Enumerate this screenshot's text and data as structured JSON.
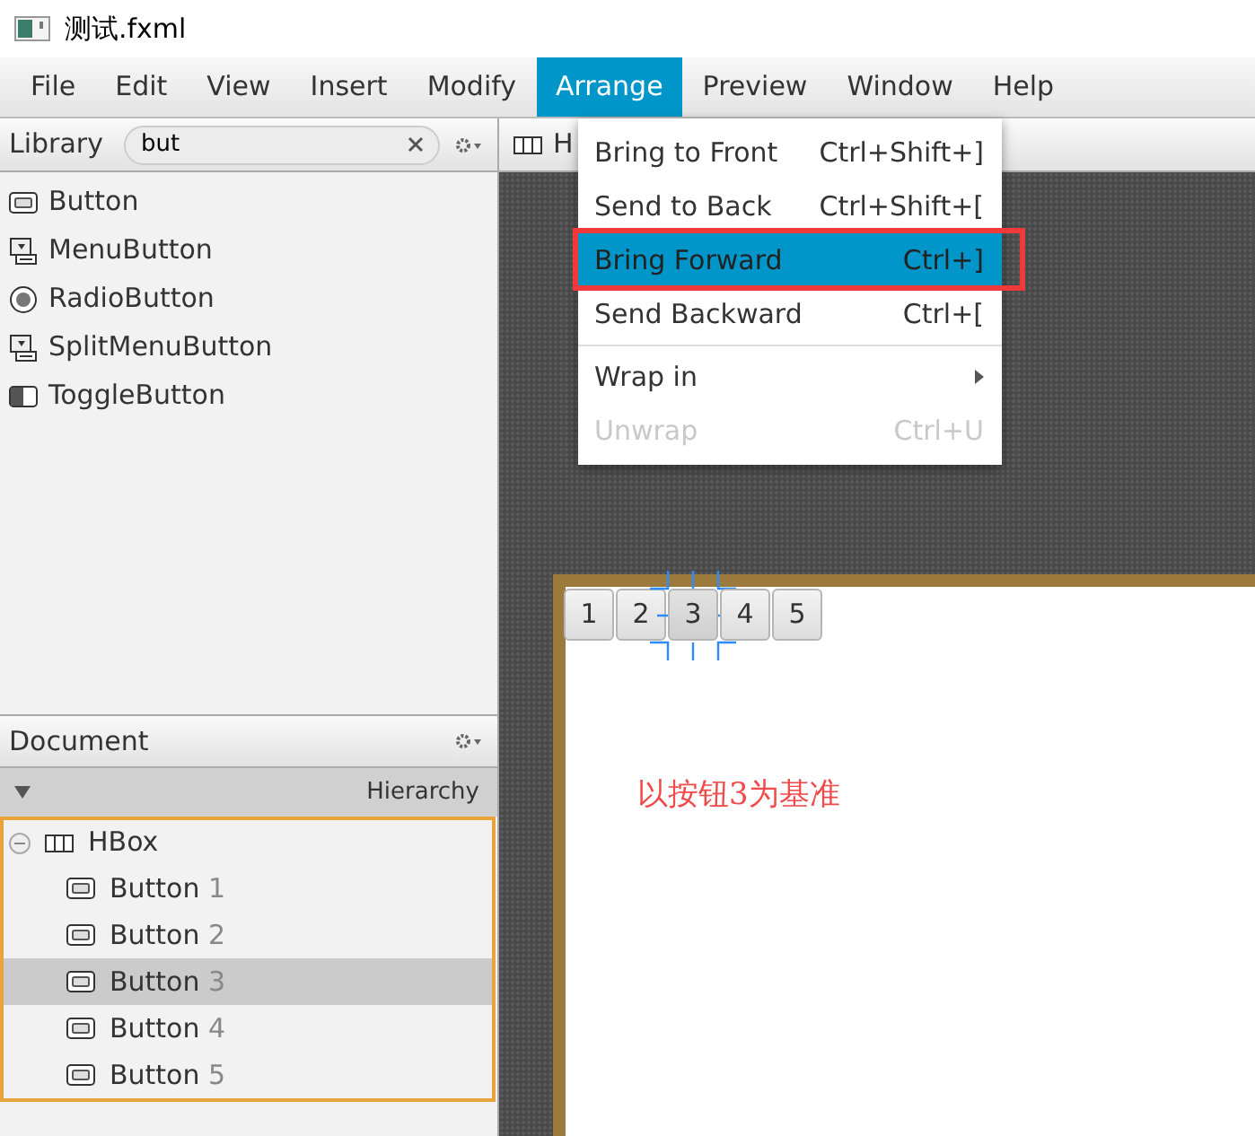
{
  "window": {
    "title": "测试.fxml"
  },
  "menu_bar": [
    {
      "label": "File",
      "selected": false
    },
    {
      "label": "Edit",
      "selected": false
    },
    {
      "label": "View",
      "selected": false
    },
    {
      "label": "Insert",
      "selected": false
    },
    {
      "label": "Modify",
      "selected": false
    },
    {
      "label": "Arrange",
      "selected": true
    },
    {
      "label": "Preview",
      "selected": false
    },
    {
      "label": "Window",
      "selected": false
    },
    {
      "label": "Help",
      "selected": false
    }
  ],
  "arrange_menu": [
    {
      "label": "Bring to Front",
      "shortcut": "Ctrl+Shift+]",
      "selected": false,
      "disabled": false,
      "marked": false
    },
    {
      "label": "Send to Back",
      "shortcut": "Ctrl+Shift+[",
      "selected": false,
      "disabled": false,
      "marked": false
    },
    {
      "label": "Bring Forward",
      "shortcut": "Ctrl+]",
      "selected": true,
      "disabled": false,
      "marked": true
    },
    {
      "label": "Send Backward",
      "shortcut": "Ctrl+[",
      "selected": false,
      "disabled": false,
      "marked": false,
      "separator_after": true
    },
    {
      "label": "Wrap in",
      "submenu": true,
      "selected": false,
      "disabled": false,
      "marked": false
    },
    {
      "label": "Unwrap",
      "shortcut": "Ctrl+U",
      "selected": false,
      "disabled": true,
      "marked": false
    }
  ],
  "library": {
    "title": "Library",
    "search": "but",
    "items": [
      {
        "label": "Button",
        "kind": "ok"
      },
      {
        "label": "MenuButton",
        "kind": "menu"
      },
      {
        "label": "RadioButton",
        "kind": "radio"
      },
      {
        "label": "SplitMenuButton",
        "kind": "menu"
      },
      {
        "label": "ToggleButton",
        "kind": "toggle"
      }
    ]
  },
  "document": {
    "title": "Document",
    "hierarchy_label": "Hierarchy",
    "tree": [
      {
        "label": "HBox",
        "expanded": true,
        "selected": false,
        "children": [
          {
            "label": "Button",
            "number": "1",
            "selected": false
          },
          {
            "label": "Button",
            "number": "2",
            "selected": false
          },
          {
            "label": "Button",
            "number": "3",
            "selected": true
          },
          {
            "label": "Button",
            "number": "4",
            "selected": false
          },
          {
            "label": "Button",
            "number": "5",
            "selected": false
          }
        ]
      }
    ]
  },
  "canvas": {
    "tab": "H",
    "buttons": [
      {
        "label": "1",
        "selected": false
      },
      {
        "label": "2",
        "selected": false
      },
      {
        "label": "3",
        "selected": true
      },
      {
        "label": "4",
        "selected": false
      },
      {
        "label": "5",
        "selected": false
      }
    ],
    "note": "以按钮3为基准"
  }
}
